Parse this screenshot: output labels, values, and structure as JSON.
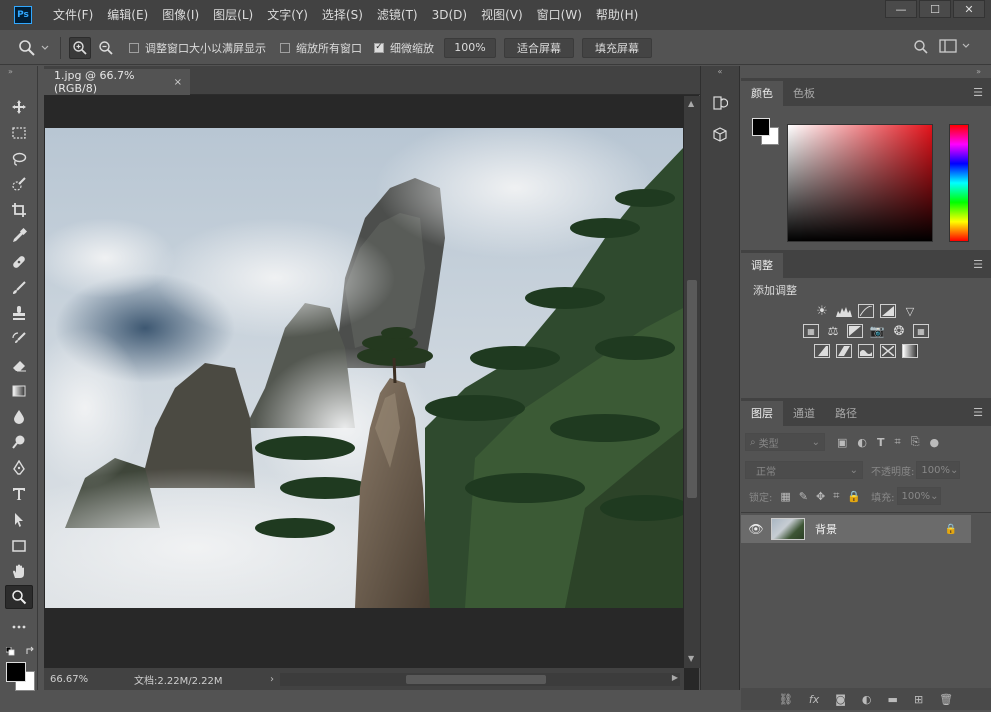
{
  "app": {
    "logo": "Ps"
  },
  "menu": [
    "文件(F)",
    "编辑(E)",
    "图像(I)",
    "图层(L)",
    "文字(Y)",
    "选择(S)",
    "滤镜(T)",
    "3D(D)",
    "视图(V)",
    "窗口(W)",
    "帮助(H)"
  ],
  "window_buttons": {
    "minimize": "—",
    "maximize": "☐",
    "close": "✕"
  },
  "options": {
    "resize_windows": "调整窗口大小以满屏显示",
    "zoom_all": "缩放所有窗口",
    "scrubby_zoom": "细微缩放",
    "zoom_value": "100%",
    "fit_screen": "适合屏幕",
    "fill_screen": "填充屏幕"
  },
  "document": {
    "tab": "1.jpg @ 66.7%(RGB/8)",
    "close": "×"
  },
  "status": {
    "zoom": "66.67%",
    "doc": "文档:2.22M/2.22M"
  },
  "color_panel": {
    "tabs": [
      "颜色",
      "色板"
    ]
  },
  "adjust_panel": {
    "tab": "调整",
    "label": "添加调整"
  },
  "layers_panel": {
    "tabs": [
      "图层",
      "通道",
      "路径"
    ],
    "filter_kind": "类型",
    "blend_mode": "正常",
    "opacity_label": "不透明度:",
    "opacity_value": "100%",
    "lock_label": "锁定:",
    "fill_label": "填充:",
    "fill_value": "100%",
    "layer_name": "背景"
  },
  "colors": {
    "foreground": "#000000",
    "background": "#ffffff",
    "accent": "#31a8ff"
  }
}
